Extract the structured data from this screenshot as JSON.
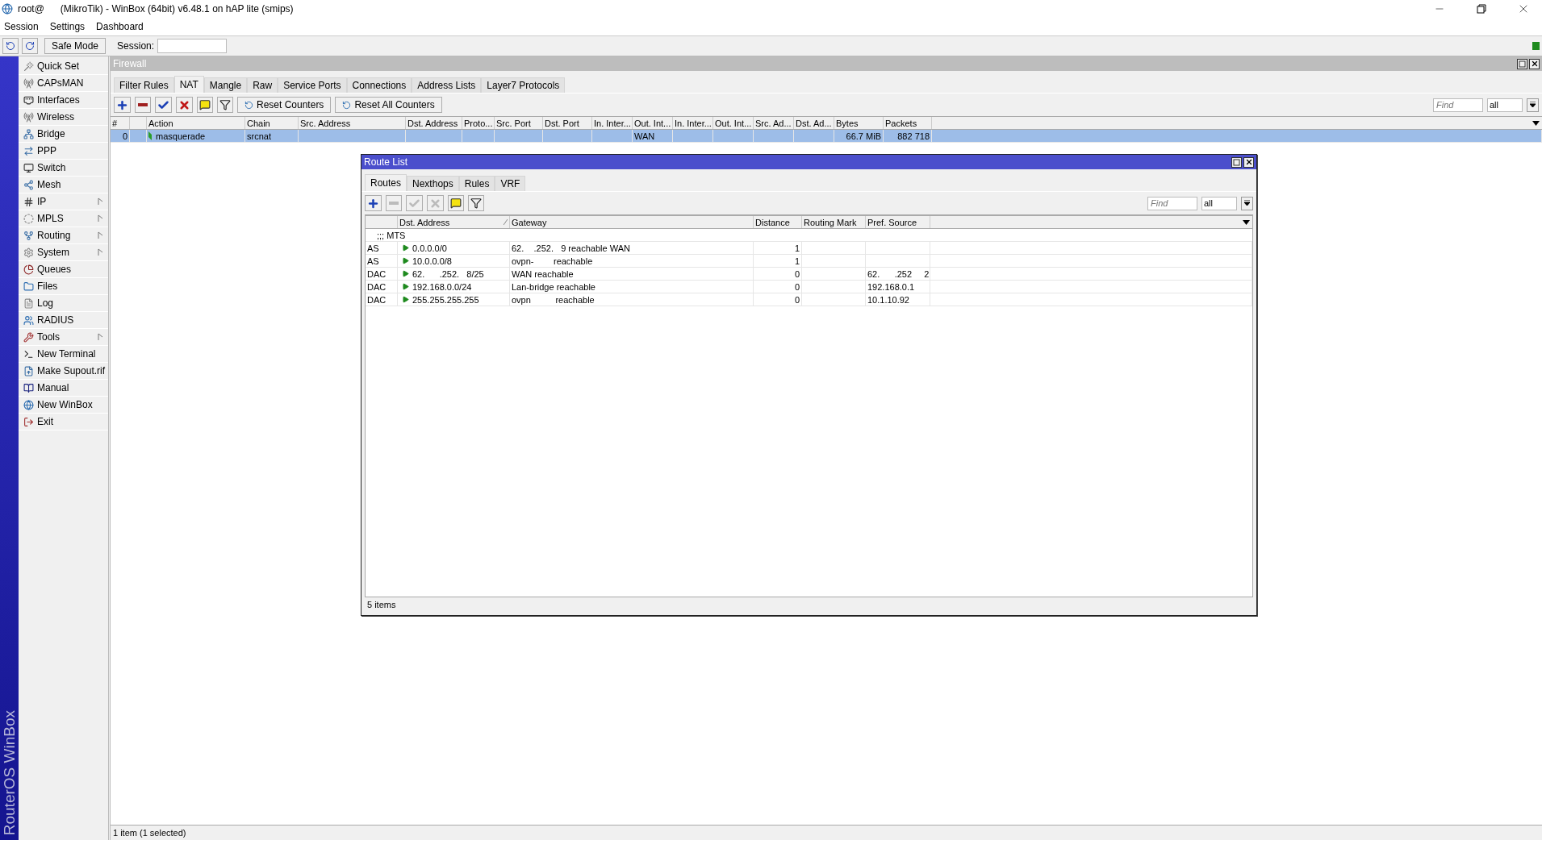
{
  "window": {
    "title": "root@      (MikroTik) - WinBox (64bit) v6.48.1 on hAP lite (smips)"
  },
  "menu": [
    "Session",
    "Settings",
    "Dashboard"
  ],
  "toolbar": {
    "safe_mode": "Safe Mode",
    "session_label": "Session:"
  },
  "sidebar": {
    "brand": "RouterOS WinBox",
    "items": [
      {
        "label": "Quick Set",
        "submenu": false
      },
      {
        "label": "CAPsMAN",
        "submenu": false
      },
      {
        "label": "Interfaces",
        "submenu": false
      },
      {
        "label": "Wireless",
        "submenu": false
      },
      {
        "label": "Bridge",
        "submenu": false
      },
      {
        "label": "PPP",
        "submenu": false
      },
      {
        "label": "Switch",
        "submenu": false
      },
      {
        "label": "Mesh",
        "submenu": false
      },
      {
        "label": "IP",
        "submenu": true
      },
      {
        "label": "MPLS",
        "submenu": true
      },
      {
        "label": "Routing",
        "submenu": true
      },
      {
        "label": "System",
        "submenu": true
      },
      {
        "label": "Queues",
        "submenu": false
      },
      {
        "label": "Files",
        "submenu": false
      },
      {
        "label": "Log",
        "submenu": false
      },
      {
        "label": "RADIUS",
        "submenu": false
      },
      {
        "label": "Tools",
        "submenu": true
      },
      {
        "label": "New Terminal",
        "submenu": false
      },
      {
        "label": "Make Supout.rif",
        "submenu": false
      },
      {
        "label": "Manual",
        "submenu": false
      },
      {
        "label": "New WinBox",
        "submenu": false
      },
      {
        "label": "Exit",
        "submenu": false
      }
    ]
  },
  "firewall": {
    "title": "Firewall",
    "tabs": [
      {
        "label": "Filter Rules",
        "selected": false
      },
      {
        "label": "NAT",
        "selected": true
      },
      {
        "label": "Mangle",
        "selected": false
      },
      {
        "label": "Raw",
        "selected": false
      },
      {
        "label": "Service Ports",
        "selected": false
      },
      {
        "label": "Connections",
        "selected": false
      },
      {
        "label": "Address Lists",
        "selected": false
      },
      {
        "label": "Layer7 Protocols",
        "selected": false
      }
    ],
    "tools": [
      {
        "kind": "add",
        "disabled": false
      },
      {
        "kind": "remove",
        "disabled": false
      },
      {
        "kind": "enable",
        "disabled": false
      },
      {
        "kind": "disable",
        "disabled": false
      },
      {
        "kind": "comment",
        "disabled": false
      },
      {
        "kind": "filter",
        "disabled": false
      }
    ],
    "buttons": [
      "Reset Counters",
      "Reset All Counters"
    ],
    "find": {
      "placeholder": "Find"
    },
    "filter": "all",
    "columns": [
      "#",
      "Action",
      "Chain",
      "Src. Address",
      "Dst. Address",
      "Proto...",
      "Src. Port",
      "Dst. Port",
      "In. Inter...",
      "Out. Int...",
      "In. Inter...",
      "Out. Int...",
      "Src. Ad...",
      "Dst. Ad...",
      "Bytes",
      "Packets"
    ],
    "rows": [
      {
        "number": "0",
        "action": "masquerade",
        "chain": "srcnat",
        "out_interface": "WAN",
        "bytes": "66.7 MiB",
        "packets": "882 718",
        "selected": true
      }
    ],
    "status": "1 item (1 selected)"
  },
  "route_list": {
    "title": "Route List",
    "tabs": [
      {
        "label": "Routes",
        "selected": true
      },
      {
        "label": "Nexthops",
        "selected": false
      },
      {
        "label": "Rules",
        "selected": false
      },
      {
        "label": "VRF",
        "selected": false
      }
    ],
    "tools": [
      {
        "kind": "add",
        "disabled": false
      },
      {
        "kind": "remove",
        "disabled": true
      },
      {
        "kind": "enable",
        "disabled": true
      },
      {
        "kind": "disable",
        "disabled": true
      },
      {
        "kind": "comment",
        "disabled": false
      },
      {
        "kind": "filter",
        "disabled": false
      }
    ],
    "find": {
      "placeholder": "Find"
    },
    "filter": "all",
    "columns": [
      "Dst. Address",
      "Gateway",
      "Distance",
      "Routing Mark",
      "Pref. Source"
    ],
    "comment": ";;; MTS",
    "rows": [
      {
        "flags": "AS",
        "dst_address": "0.0.0.0/0",
        "gateway": "62.    .252.   9 reachable WAN",
        "distance": "1"
      },
      {
        "flags": "AS",
        "dst_address": "10.0.0.0/8",
        "gateway": "ovpn-        reachable",
        "distance": "1"
      },
      {
        "flags": "DAC",
        "dst_address": "62.      .252.   8/25",
        "gateway": "WAN reachable",
        "distance": "0",
        "pref_source": "62.      .252     2"
      },
      {
        "flags": "DAC",
        "dst_address": "192.168.0.0/24",
        "gateway": "Lan-bridge reachable",
        "distance": "0",
        "pref_source": "192.168.0.1"
      },
      {
        "flags": "DAC",
        "dst_address": "255.255.255.255",
        "gateway": "ovpn          reachable",
        "distance": "0",
        "pref_source": "10.1.10.92"
      }
    ],
    "status": "5 items"
  }
}
